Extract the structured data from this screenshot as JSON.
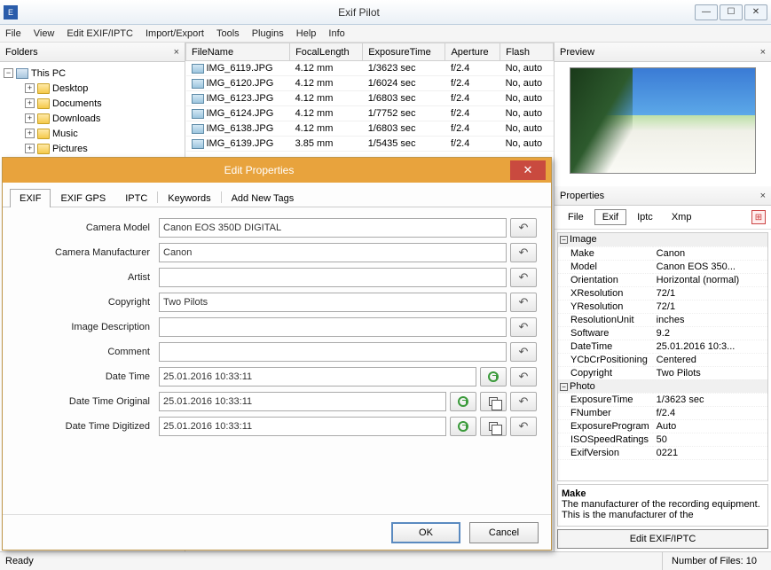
{
  "window": {
    "title": "Exif Pilot"
  },
  "menu": [
    "File",
    "View",
    "Edit EXIF/IPTC",
    "Import/Export",
    "Tools",
    "Plugins",
    "Help",
    "Info"
  ],
  "folders": {
    "title": "Folders",
    "root": "This PC",
    "items": [
      "Desktop",
      "Documents",
      "Downloads",
      "Music",
      "Pictures"
    ]
  },
  "file_table": {
    "columns": [
      "FileName",
      "FocalLength",
      "ExposureTime",
      "Aperture",
      "Flash"
    ],
    "rows": [
      {
        "name": "IMG_6119.JPG",
        "fl": "4.12 mm",
        "exp": "1/3623 sec",
        "ap": "f/2.4",
        "flash": "No, auto"
      },
      {
        "name": "IMG_6120.JPG",
        "fl": "4.12 mm",
        "exp": "1/6024 sec",
        "ap": "f/2.4",
        "flash": "No, auto"
      },
      {
        "name": "IMG_6123.JPG",
        "fl": "4.12 mm",
        "exp": "1/6803 sec",
        "ap": "f/2.4",
        "flash": "No, auto"
      },
      {
        "name": "IMG_6124.JPG",
        "fl": "4.12 mm",
        "exp": "1/7752 sec",
        "ap": "f/2.4",
        "flash": "No, auto"
      },
      {
        "name": "IMG_6138.JPG",
        "fl": "4.12 mm",
        "exp": "1/6803 sec",
        "ap": "f/2.4",
        "flash": "No, auto"
      },
      {
        "name": "IMG_6139.JPG",
        "fl": "3.85 mm",
        "exp": "1/5435 sec",
        "ap": "f/2.4",
        "flash": "No, auto"
      }
    ]
  },
  "preview": {
    "title": "Preview"
  },
  "properties": {
    "title": "Properties",
    "tabs": [
      "File",
      "Exif",
      "Iptc",
      "Xmp"
    ],
    "active_tab": "Exif",
    "groups": [
      {
        "name": "Image",
        "rows": [
          {
            "k": "Make",
            "v": "Canon"
          },
          {
            "k": "Model",
            "v": "Canon EOS 350..."
          },
          {
            "k": "Orientation",
            "v": "Horizontal (normal)"
          },
          {
            "k": "XResolution",
            "v": "72/1"
          },
          {
            "k": "YResolution",
            "v": "72/1"
          },
          {
            "k": "ResolutionUnit",
            "v": "inches"
          },
          {
            "k": "Software",
            "v": "9.2"
          },
          {
            "k": "DateTime",
            "v": "25.01.2016 10:3..."
          },
          {
            "k": "YCbCrPositioning",
            "v": "Centered"
          },
          {
            "k": "Copyright",
            "v": "Two Pilots"
          }
        ]
      },
      {
        "name": "Photo",
        "rows": [
          {
            "k": "ExposureTime",
            "v": "1/3623 sec"
          },
          {
            "k": "FNumber",
            "v": "f/2.4"
          },
          {
            "k": "ExposureProgram",
            "v": "Auto"
          },
          {
            "k": "ISOSpeedRatings",
            "v": "50"
          },
          {
            "k": "ExifVersion",
            "v": "0221"
          }
        ]
      }
    ],
    "desc_title": "Make",
    "desc_text": "The manufacturer of the recording equipment. This is the manufacturer of the",
    "edit_btn": "Edit EXIF/IPTC"
  },
  "dialog": {
    "title": "Edit Properties",
    "tabs": [
      "EXIF",
      "EXIF GPS",
      "IPTC",
      "Keywords",
      "Add New Tags"
    ],
    "fields": [
      {
        "label": "Camera Model",
        "value": "Canon EOS 350D DIGITAL",
        "type": "text"
      },
      {
        "label": "Camera Manufacturer",
        "value": "Canon",
        "type": "text"
      },
      {
        "label": "Artist",
        "value": "",
        "type": "text"
      },
      {
        "label": "Copyright",
        "value": "Two Pilots",
        "type": "text"
      },
      {
        "label": "Image Description",
        "value": "",
        "type": "text"
      },
      {
        "label": "Comment",
        "value": "",
        "type": "text"
      },
      {
        "label": "Date Time",
        "value": "25.01.2016 10:33:11",
        "type": "date"
      },
      {
        "label": "Date Time Original",
        "value": "25.01.2016 10:33:11",
        "type": "date_copy"
      },
      {
        "label": "Date Time Digitized",
        "value": "25.01.2016 10:33:11",
        "type": "date_copy"
      }
    ],
    "ok": "OK",
    "cancel": "Cancel"
  },
  "status": {
    "ready": "Ready",
    "files": "Number of Files: 10"
  }
}
